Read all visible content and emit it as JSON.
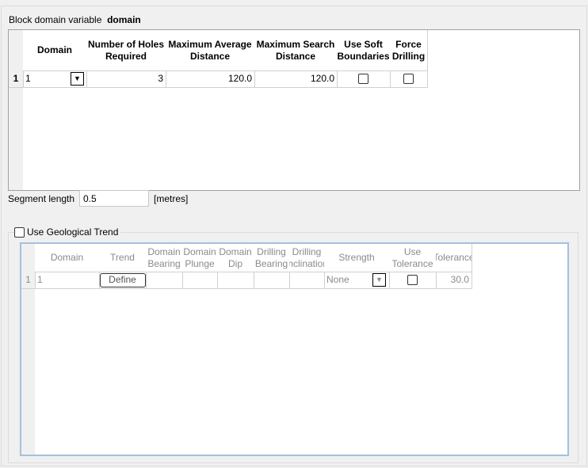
{
  "block_domain": {
    "label": "Block domain variable",
    "value": "domain"
  },
  "table1": {
    "columns": [
      "Domain",
      "Number of Holes Required",
      "Maximum Average Distance",
      "Maximum Search Distance",
      "Use Soft Boundaries",
      "Force Drilling"
    ],
    "rows": [
      {
        "index": "1",
        "domain": "1",
        "holes": "3",
        "max_avg": "120.0",
        "max_search": "120.0",
        "soft": false,
        "force": false
      }
    ]
  },
  "segment": {
    "label": "Segment length",
    "value": "0.5",
    "unit": "[metres]"
  },
  "trend": {
    "checkbox_label": "Use Geological Trend",
    "checked": false,
    "columns": [
      "Domain",
      "Trend",
      "Domain Bearing",
      "Domain Plunge",
      "Domain Dip",
      "Drilling Bearing",
      "Drilling Inclination",
      "Strength",
      "Use Tolerance",
      "Tolerance"
    ],
    "rows": [
      {
        "index": "1",
        "domain": "1",
        "trend_button": "Define",
        "strength": "None",
        "use_tolerance": false,
        "tolerance": "30.0"
      }
    ]
  }
}
